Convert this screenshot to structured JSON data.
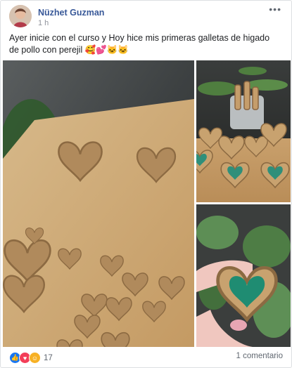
{
  "post": {
    "author": "Nüzhet Guzman",
    "time": "1 h",
    "text": "Ayer inicie con el curso y Hoy hice mis primeras galletas de higado de pollo con perejil 🥰💕🐱🐱",
    "reaction_count": "17",
    "comments": "1 comentario"
  },
  "icons": [
    "avatar",
    "more-options-icon",
    "like-reaction-icon",
    "love-reaction-icon",
    "haha-reaction-icon"
  ],
  "colors": {
    "author": "#385898",
    "like": "#1877f2",
    "love": "#f33e58",
    "wow": "#f7b125"
  }
}
